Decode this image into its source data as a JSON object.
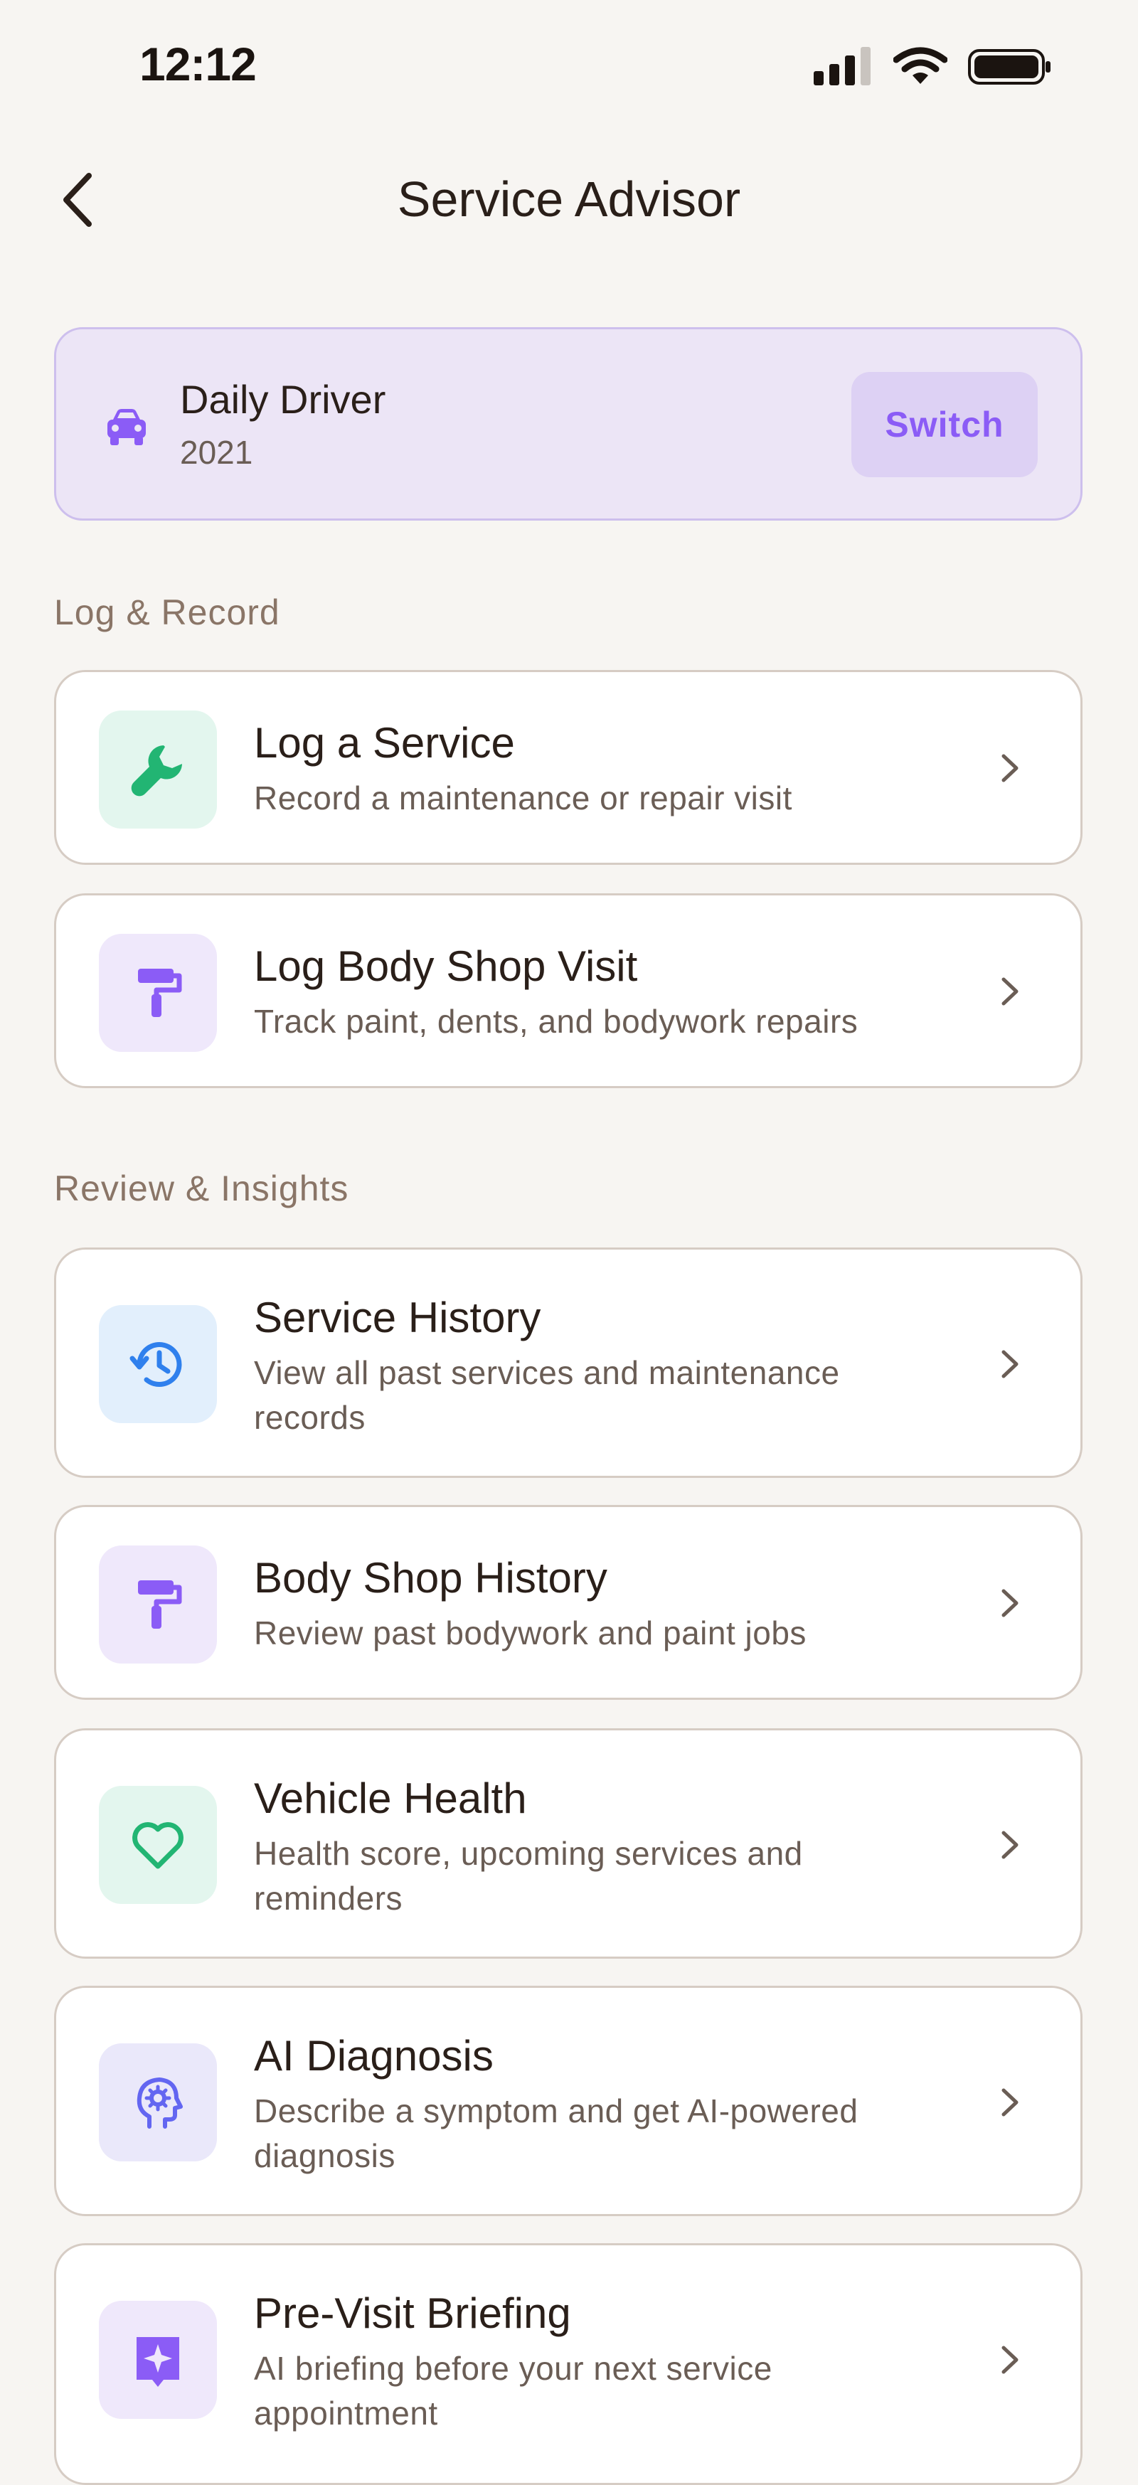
{
  "status": {
    "time": "12:12"
  },
  "nav": {
    "title": "Service Advisor"
  },
  "vehicle": {
    "name": "Daily Driver",
    "year": "2021",
    "switch_label": "Switch"
  },
  "sections": [
    {
      "title": "Log & Record"
    },
    {
      "title": "Review & Insights"
    }
  ],
  "rows": [
    {
      "title": "Log a Service",
      "subtitle": "Record a maintenance or repair visit",
      "icon": "wrench-icon"
    },
    {
      "title": "Log Body Shop Visit",
      "subtitle": "Track paint, dents, and bodywork repairs",
      "icon": "paint-roller-icon"
    },
    {
      "title": "Service History",
      "subtitle": "View all past services and maintenance records",
      "icon": "history-icon"
    },
    {
      "title": "Body Shop History",
      "subtitle": "Review past bodywork and paint jobs",
      "icon": "paint-roller-icon"
    },
    {
      "title": "Vehicle Health",
      "subtitle": "Health score, upcoming services and reminders",
      "icon": "heart-icon"
    },
    {
      "title": "AI Diagnosis",
      "subtitle": "Describe a symptom and get AI-powered diagnosis",
      "icon": "brain-gear-icon"
    },
    {
      "title": "Pre-Visit Briefing",
      "subtitle": "AI briefing before your next service appointment",
      "icon": "sparkle-badge-icon"
    }
  ],
  "colors": {
    "background": "#f7f5f2",
    "accent_purple": "#8b5cf6",
    "green": "#22b573",
    "blue": "#2f80ed"
  }
}
